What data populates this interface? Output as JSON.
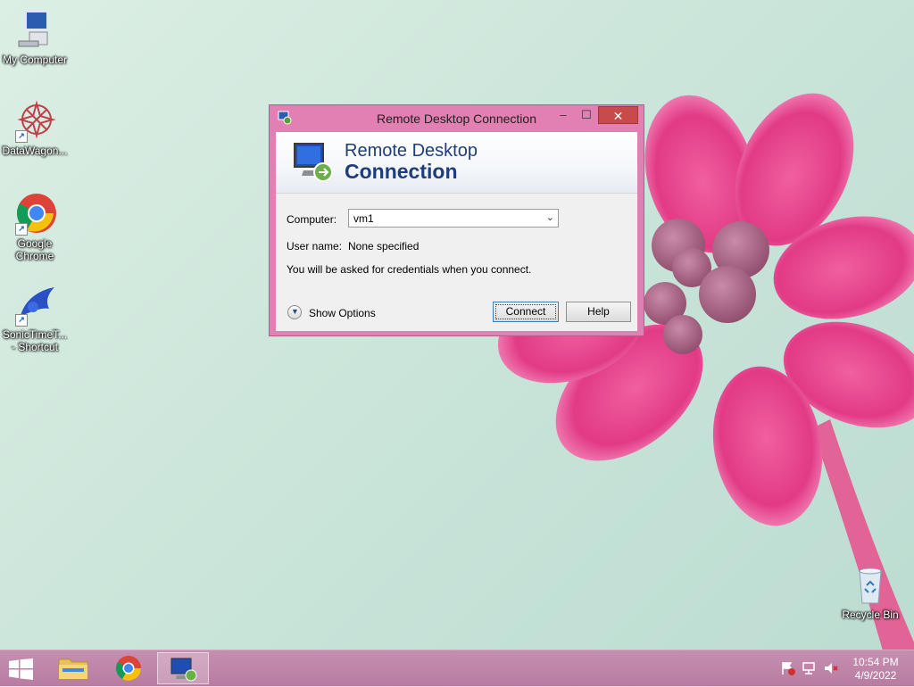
{
  "desktop": {
    "icons": [
      {
        "label": "My Computer"
      },
      {
        "label": "DataWagon..."
      },
      {
        "label": "Google Chrome"
      },
      {
        "label": "SonicTimeT... - Shortcut"
      },
      {
        "label": "Recycle Bin"
      }
    ]
  },
  "window": {
    "title": "Remote Desktop Connection",
    "controls": {
      "minimize": "–",
      "maximize": "☐",
      "close": "✕"
    },
    "banner": {
      "line1": "Remote Desktop",
      "line2": "Connection"
    },
    "form": {
      "computer_label": "Computer:",
      "computer_value": "vm1",
      "user_label": "User name:",
      "user_value": "None specified",
      "info": "You will be asked for credentials when you connect."
    },
    "show_options": "Show Options",
    "buttons": {
      "connect": "Connect",
      "help": "Help"
    }
  },
  "taskbar": {
    "clock": {
      "time": "10:54 PM",
      "date": "4/9/2022"
    }
  },
  "colors": {
    "window_frame": "#e27fb3",
    "close_button": "#c74b4b",
    "banner_text": "#1f3d7a",
    "taskbar": "#b97ca2"
  }
}
